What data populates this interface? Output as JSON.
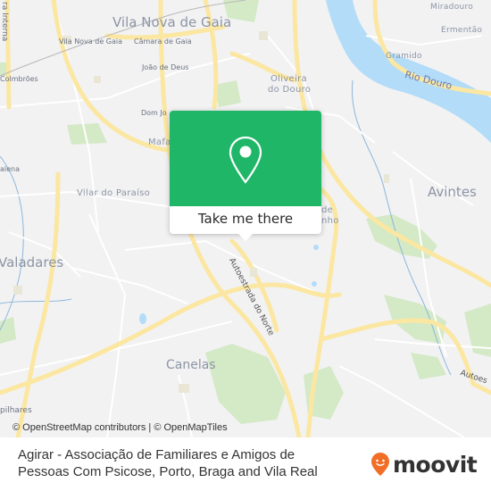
{
  "map": {
    "labels": {
      "vila_nova_de_gaia_city": "Vila Nova de Gaia",
      "vila_nova_de_gaia": "Vila Nova de Gaia",
      "camara_de_gaia": "Câmara de Gaia",
      "joao_de_deus": "João de Deus",
      "colmbroes": "Colmbrões",
      "via_interna": "ra Interna",
      "dom_joao": "Dom Jo",
      "mafamude": "Mafa",
      "oliveira_do_douro_1": "Oliveira",
      "oliveira_do_douro_2": "do Douro",
      "miradouro": "Miradouro",
      "ermentao": "Ermentão",
      "gramido": "Gramido",
      "rio_douro": "Rio Douro",
      "vilar_do_paraiso": "Vilar do Paraíso",
      "valadares": "Valadares",
      "madalena": "alena",
      "avintes": "Avintes",
      "de": "de",
      "nho": "nho",
      "autoestrada_do_norte": "Autoestrada do Norte",
      "canelas": "Canelas",
      "pilhares": "pilhares",
      "autoestrada_right": "Autoes"
    },
    "attribution": "© OpenStreetMap contributors | © OpenMapTiles",
    "colors": {
      "background": "#f2f2f3",
      "road_major": "#fbe7a1",
      "road_minor": "#ffffff",
      "water": "#b3dcf8",
      "park": "#cfe8c0"
    }
  },
  "popup": {
    "icon": "location-pin-icon",
    "button_label": "Take me there",
    "color": "#1fb767"
  },
  "footer": {
    "title_line1": "Agirar - Associação de Familiares e Amigos de",
    "title_line2": "Pessoas Com Psicose, Porto, Braga and Vila Real",
    "logo_text": "moovit",
    "logo_icon": "moovit-pin-icon",
    "logo_color": "#f26e27"
  }
}
